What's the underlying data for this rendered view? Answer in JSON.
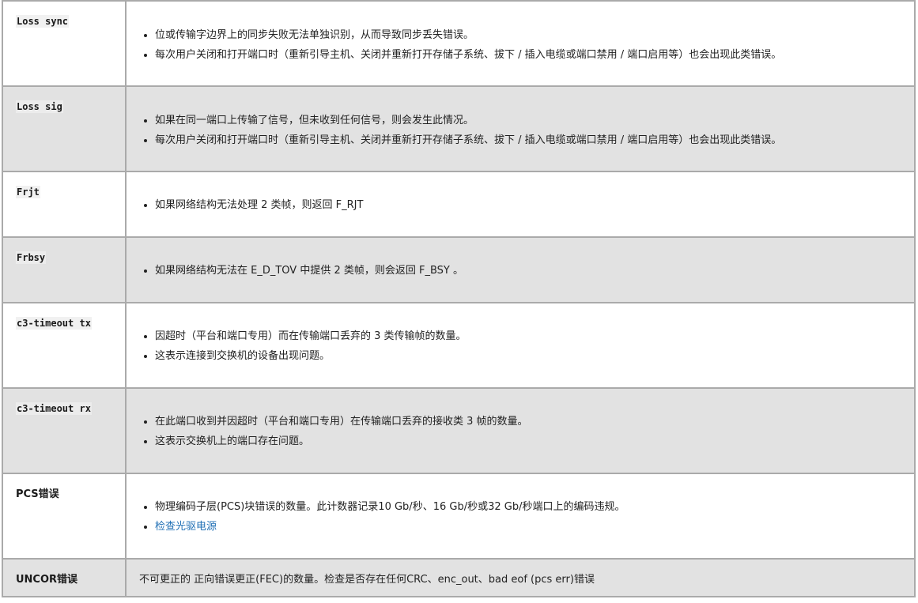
{
  "rows": [
    {
      "term": "Loss sync",
      "bullets": [
        "位或传输字边界上的同步失败无法单独识别，从而导致同步丢失错误。",
        "每次用户关闭和打开端口时（重新引导主机、关闭并重新打开存储子系统、拔下 / 插入电缆或端口禁用 / 端口启用等）也会出现此类错误。"
      ]
    },
    {
      "term": "Loss sig",
      "bullets": [
        "如果在同一端口上传输了信号，但未收到任何信号，则会发生此情况。",
        "每次用户关闭和打开端口时（重新引导主机、关闭并重新打开存储子系统、拔下 / 插入电缆或端口禁用 / 端口启用等）也会出现此类错误。"
      ]
    },
    {
      "term": "Frjt",
      "bullets": [
        "如果网络结构无法处理 2 类帧，则返回 F_RJT"
      ]
    },
    {
      "term": "Frbsy",
      "bullets": [
        "如果网络结构无法在 E_D_TOV 中提供 2 类帧，则会返回 F_BSY 。"
      ]
    },
    {
      "term": "c3-timeout tx",
      "bullets": [
        "因超时（平台和端口专用）而在传输端口丢弃的 3 类传输帧的数量。",
        "这表示连接到交换机的设备出现问题。"
      ]
    },
    {
      "term": "c3-timeout rx",
      "bullets": [
        "在此端口收到并因超时（平台和端口专用）在传输端口丢弃的接收类 3 帧的数量。",
        "这表示交换机上的端口存在问题。"
      ]
    },
    {
      "term": "PCS错误",
      "bullets": [
        "物理编码子层(PCS)块错误的数量。此计数器记录10 Gb/秒、16 Gb/秒或32 Gb/秒端口上的编码违规。"
      ],
      "link": "检查光驱电源"
    },
    {
      "term": "UNCOR错误",
      "desc_prefix": "不可更正的 ",
      "desc_link": "正向错误更正(FEC)",
      "desc_suffix": "的数量。检查是否存在任何CRC、enc_out、bad eof (pcs err)错误"
    }
  ]
}
